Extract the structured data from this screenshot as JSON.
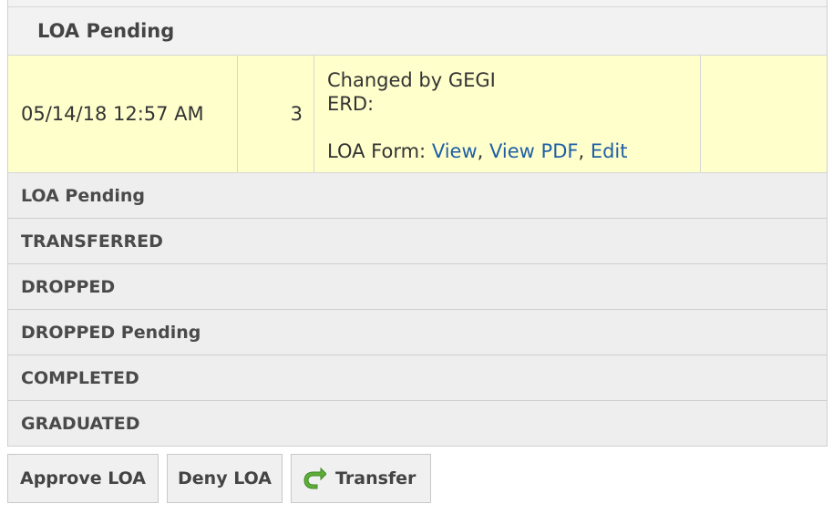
{
  "section": {
    "title": "LOA Pending"
  },
  "entry": {
    "datetime": "05/14/18 12:57 AM",
    "count": "3",
    "changed_by": "Changed by GEGI",
    "erd_label": "ERD:",
    "form_label": "LOA Form: ",
    "links": {
      "view": "View",
      "view_pdf": "View PDF",
      "edit": "Edit",
      "separator": ", "
    }
  },
  "statuses": [
    "LOA Pending",
    "TRANSFERRED",
    "DROPPED",
    "DROPPED Pending",
    "COMPLETED",
    "GRADUATED"
  ],
  "buttons": {
    "approve": "Approve LOA",
    "deny": "Deny LOA",
    "transfer": "Transfer"
  },
  "icons": {
    "transfer": "transfer-arrow-icon"
  },
  "colors": {
    "highlight_row": "#ffffcc",
    "link": "#1f5fa6",
    "transfer_icon": "#5fae3a"
  }
}
